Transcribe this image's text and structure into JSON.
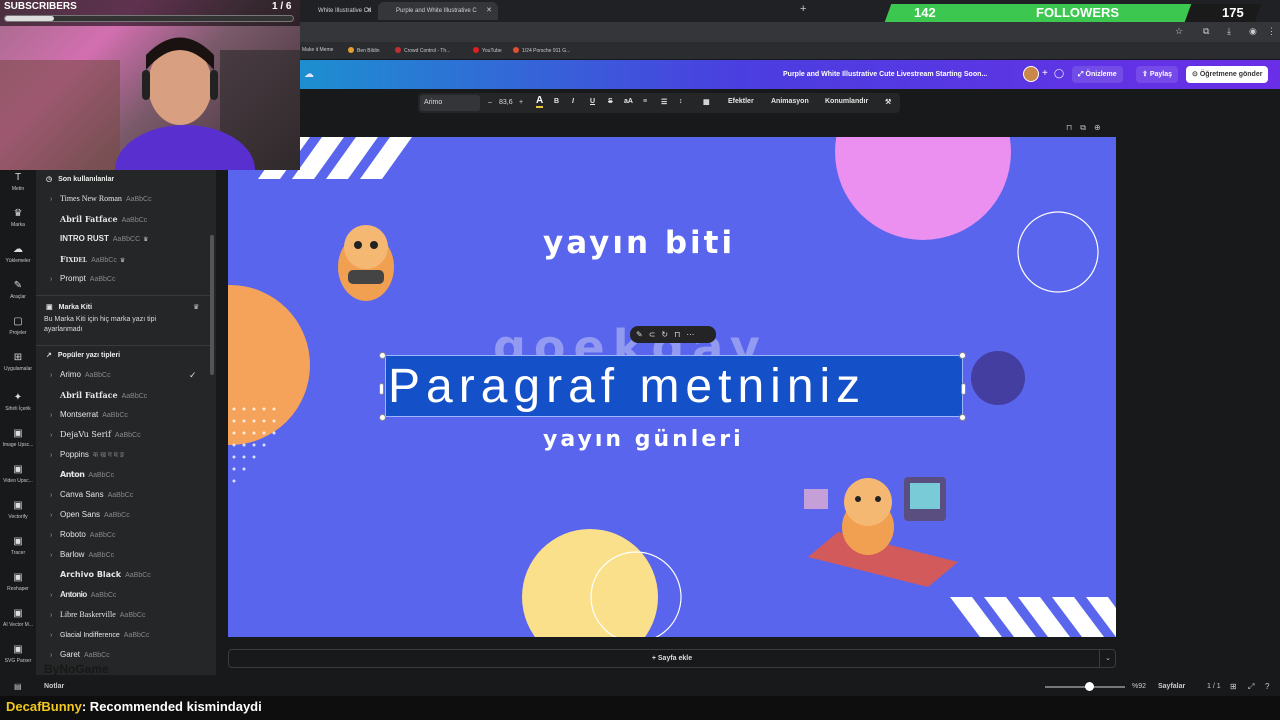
{
  "stream": {
    "subs_label": "SUBSCRIBERS",
    "subs_count": "1 / 6",
    "subs_progress": 0.17,
    "followers_label": "FOLLOWERS",
    "followers_current": "142",
    "followers_goal": "175",
    "followers_progress": 0.81,
    "chat_user": "DecafBunny",
    "chat_message": ": Recommended kismindaydi",
    "watermark": "ByNoGame"
  },
  "browser": {
    "tabs": [
      {
        "label": "White Illustrative Cu"
      },
      {
        "label": "Purple and White Illustrative C"
      }
    ],
    "new_tab": "+",
    "bookmarks": [
      {
        "label": "Make it Meme",
        "color": "#888888"
      },
      {
        "label": "Ben Bildin",
        "color": "#e0a030"
      },
      {
        "label": "Crowd Control - Th...",
        "color": "#c03030"
      },
      {
        "label": "YouTube",
        "color": "#e02020"
      },
      {
        "label": "1/24 Porsche 911 G...",
        "color": "#e05030"
      }
    ]
  },
  "canva_header": {
    "doc_title": "Purple and White Illustrative Cute Livestream Starting Soon...",
    "preview": "Önizleme",
    "share": "Paylaş",
    "send_teacher": "Öğretmene gönder"
  },
  "text_toolbar": {
    "font": "Arimo",
    "font_size": "83,6",
    "effects": "Efektler",
    "animation": "Animasyon",
    "position": "Konumlandır"
  },
  "rail": [
    {
      "label": "Metin",
      "icon": "T"
    },
    {
      "label": "Marka",
      "icon": "♛"
    },
    {
      "label": "Yüklemeler",
      "icon": "☁"
    },
    {
      "label": "Araçlar",
      "icon": "✎"
    },
    {
      "label": "Projeler",
      "icon": "▢"
    },
    {
      "label": "Uygulamalar",
      "icon": "⊞"
    },
    {
      "label": "Sihirli İçerik",
      "icon": "✦"
    },
    {
      "label": "Image Upsc...",
      "icon": "▣"
    },
    {
      "label": "Video Upsc...",
      "icon": "▣"
    },
    {
      "label": "Vectorify",
      "icon": "▣"
    },
    {
      "label": "Tracer",
      "icon": "▣"
    },
    {
      "label": "Reshaper",
      "icon": "▣"
    },
    {
      "label": "AI Vector M...",
      "icon": "▣"
    },
    {
      "label": "SVG Parser",
      "icon": "▣"
    }
  ],
  "font_panel": {
    "recent_title": "Son kullanılanlar",
    "recent": [
      {
        "name": "Times New Roman",
        "sample": "AaBbCc",
        "crown": ""
      },
      {
        "name": "Abril Fatface",
        "sample": "AaBbCc",
        "crown": ""
      },
      {
        "name": "INTRO RUST",
        "sample": "AaBbCC",
        "crown": "♛"
      },
      {
        "name": "Fixdel",
        "sample": "AaBbCc",
        "crown": "♛"
      },
      {
        "name": "Prompt",
        "sample": "AaBbCc",
        "crown": ""
      }
    ],
    "brandkit_title": "Marka Kiti",
    "brandkit_desc": "Bu Marka Kiti için hiç marka yazı tipi ayarlanmadı",
    "popular_title": "Popüler yazı tipleri",
    "popular": [
      {
        "name": "Arimo",
        "sample": "AaBbCc"
      },
      {
        "name": "Abril Fatface",
        "sample": "AaBbCc"
      },
      {
        "name": "Montserrat",
        "sample": "AaBbCc"
      },
      {
        "name": "DejaVu Serif",
        "sample": "AaBbCc"
      },
      {
        "name": "Poppins",
        "sample": "क ख ग घ ङ"
      },
      {
        "name": "Anton",
        "sample": "AaBbCc"
      },
      {
        "name": "Canva Sans",
        "sample": "AaBbCc"
      },
      {
        "name": "Open Sans",
        "sample": "AaBbCc"
      },
      {
        "name": "Roboto",
        "sample": "AaBbCc"
      },
      {
        "name": "Barlow",
        "sample": "AaBbCc"
      },
      {
        "name": "Archivo Black",
        "sample": "AaBbCc"
      },
      {
        "name": "Antonio",
        "sample": "AaBbCc"
      },
      {
        "name": "Libre Baskerville",
        "sample": "AaBbCc"
      },
      {
        "name": "Glacial Indifference",
        "sample": "AaBbCc"
      },
      {
        "name": "Garet",
        "sample": "AaBbCc"
      }
    ]
  },
  "canvas": {
    "heading_top": "yayın biti",
    "heading_ghost": "goekday",
    "paragraph": "Paragraf metniniz",
    "heading_bottom": "yayın günleri",
    "bg_color": "#5865ec"
  },
  "add_page": "+ Sayfa ekle",
  "bottom_bar": {
    "notes": "Notlar",
    "zoom": "%92",
    "pages_label": "Sayfalar",
    "pages_count": "1 / 1"
  }
}
